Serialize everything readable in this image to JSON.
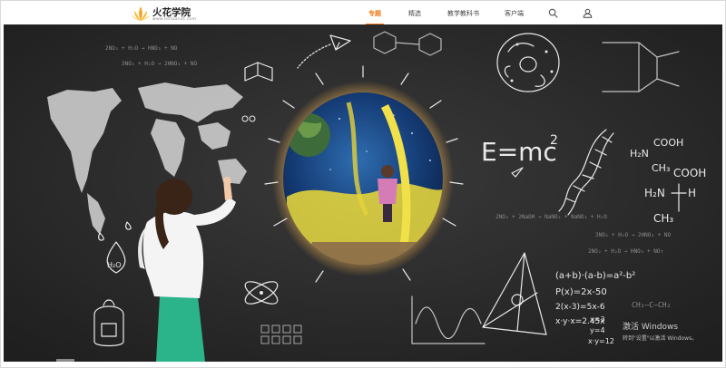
{
  "brand": {
    "title": "火花学院",
    "subtitle": "www.hhtuanxt.com"
  },
  "nav": {
    "items": [
      {
        "label": "专题",
        "active": true
      },
      {
        "label": "精选",
        "active": false
      },
      {
        "label": "教学教科书",
        "active": false
      },
      {
        "label": "客户端",
        "active": false
      }
    ],
    "icons": [
      "search-icon",
      "user-icon"
    ],
    "accent_color": "#f3781b"
  },
  "banner": {
    "formula_emc2": "E=mc",
    "formula_exp": "2",
    "eq_top1": "2NO₂ + H₂O → HNO₃ + NO",
    "eq_top2": "3NO₂ + H₂O → 2HNO₃ + NO",
    "eq_mid1": "2NO₂ + 2NaOH → NaNO₂ + NaNO₃ + H₂O",
    "eq_mid2": "3NO₂ + H₂O → 2HNO₃ + NO",
    "eq_mid3": "2NO₂ + H₂O → HNO₃ + NO↑",
    "chem_cooh1": "COOH",
    "chem_h2n": "H₂N",
    "chem_ch3": "CH₃",
    "chem_cooh2": "COOH",
    "chem_h2n2": "H₂N",
    "chem_h": "H",
    "chem_h3": "H",
    "chem_ch3b": "CH₃",
    "math1": "(a+b)·(a-b)=a²-b²",
    "math2": "P(x)=2x-50",
    "math3": "2(x-3)=5x-6",
    "math4": "x·y·x=2.45x",
    "math5": "x=3",
    "math6": "y=4",
    "math7": "x·y=12",
    "h2o_drop": "H₂O",
    "right_chem": "CH₂—C—CH₂",
    "watermark_title": "激活 Windows",
    "watermark_sub": "转到\"设置\"以激活 Windows。"
  }
}
